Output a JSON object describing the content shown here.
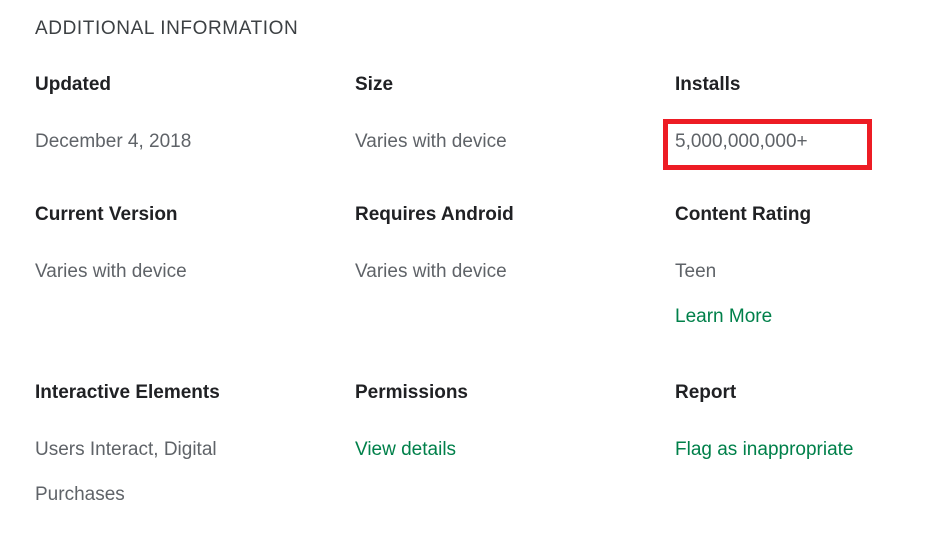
{
  "section": {
    "title": "ADDITIONAL INFORMATION"
  },
  "colors": {
    "label": "#202124",
    "value": "#5f6368",
    "link": "#00804a",
    "annotation": "#ed1c24",
    "background": "#ffffff"
  },
  "rows": [
    {
      "cells": [
        {
          "label": "Updated",
          "value": "December 4, 2018"
        },
        {
          "label": "Size",
          "value": "Varies with device"
        },
        {
          "label": "Installs",
          "value": "5,000,000,000+",
          "highlighted": true
        }
      ]
    },
    {
      "cells": [
        {
          "label": "Current Version",
          "value": "Varies with device"
        },
        {
          "label": "Requires Android",
          "value": "Varies with device"
        },
        {
          "label": "Content Rating",
          "value": "Teen",
          "link": "Learn More"
        }
      ]
    },
    {
      "cells": [
        {
          "label": "Interactive Elements",
          "value": "Users Interact, Digital Purchases"
        },
        {
          "label": "Permissions",
          "link": "View details"
        },
        {
          "label": "Report",
          "link": "Flag as inappropriate"
        }
      ]
    }
  ],
  "annotation": {
    "target": "installs-value",
    "shape": "rectangle",
    "color": "#ed1c24"
  }
}
